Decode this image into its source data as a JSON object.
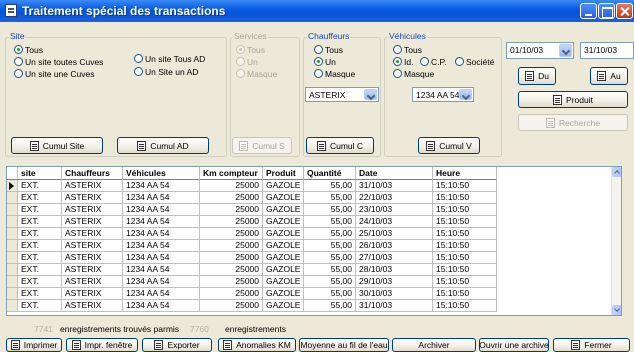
{
  "window": {
    "title": "Traitement spécial des transactions"
  },
  "site": {
    "title": "Site",
    "options": [
      "Tous",
      "Un site toutes Cuves",
      "Un site une Cuves",
      "Un site Tous AD",
      "Un Site un AD"
    ],
    "selected": "Tous",
    "cumul_site": "Cumul Site",
    "cumul_ad": "Cumul AD"
  },
  "services": {
    "title": "Services",
    "options": [
      "Tous",
      "Un",
      "Masque"
    ],
    "selected": "Tous",
    "cumul": "Cumul S"
  },
  "chauffeurs": {
    "title": "Chauffeurs",
    "options": [
      "Tous",
      "Un",
      "Masque"
    ],
    "selected": "Un",
    "combo_value": "ASTERIX",
    "cumul": "Cumul C"
  },
  "vehicules": {
    "title": "Véhicules",
    "options": [
      "Tous",
      "Id.",
      "C.P.",
      "Société",
      "Masque"
    ],
    "selected": "Id.",
    "combo_value": "1234 AA 54",
    "cumul": "Cumul V"
  },
  "dates": {
    "from": "01/10/03",
    "to": "31/10/03",
    "du_label": "Du",
    "au_label": "Au",
    "produit_label": "Produit",
    "recherche_label": "Recherche"
  },
  "table": {
    "columns": [
      "site",
      "Chauffeurs",
      "Véhicules",
      "Km compteur",
      "Produit",
      "Quantité",
      "Date",
      "Heure"
    ],
    "rows": [
      [
        "EXT.",
        "ASTERIX",
        "1234 AA 54",
        "25000",
        "GAZOLE",
        "55,00",
        "31/10/03",
        "15:10:50"
      ],
      [
        "EXT.",
        "ASTERIX",
        "1234 AA 54",
        "25000",
        "GAZOLE",
        "55,00",
        "22/10/03",
        "15:10:50"
      ],
      [
        "EXT.",
        "ASTERIX",
        "1234 AA 54",
        "25000",
        "GAZOLE",
        "55,00",
        "23/10/03",
        "15:10:50"
      ],
      [
        "EXT.",
        "ASTERIX",
        "1234 AA 54",
        "25000",
        "GAZOLE",
        "55,00",
        "24/10/03",
        "15:10:50"
      ],
      [
        "EXT.",
        "ASTERIX",
        "1234 AA 54",
        "25000",
        "GAZOLE",
        "55,00",
        "25/10/03",
        "15:10:50"
      ],
      [
        "EXT.",
        "ASTERIX",
        "1234 AA 54",
        "25000",
        "GAZOLE",
        "55,00",
        "26/10/03",
        "15:10:50"
      ],
      [
        "EXT.",
        "ASTERIX",
        "1234 AA 54",
        "25000",
        "GAZOLE",
        "55,00",
        "27/10/03",
        "15:10:50"
      ],
      [
        "EXT.",
        "ASTERIX",
        "1234 AA 54",
        "25000",
        "GAZOLE",
        "55,00",
        "28/10/03",
        "15:10:50"
      ],
      [
        "EXT.",
        "ASTERIX",
        "1234 AA 54",
        "25000",
        "GAZOLE",
        "55,00",
        "29/10/03",
        "15:10:50"
      ],
      [
        "EXT.",
        "ASTERIX",
        "1234 AA 54",
        "25000",
        "GAZOLE",
        "55,00",
        "30/10/03",
        "15:10:50"
      ],
      [
        "EXT.",
        "ASTERIX",
        "1234 AA 54",
        "25000",
        "GAZOLE",
        "55,00",
        "31/10/03",
        "15:10:50"
      ]
    ]
  },
  "status": {
    "found_count": "7741",
    "found_label": "enregistrements trouvés parmis",
    "total_count": "7760",
    "total_label": "enregistrements"
  },
  "bottom_buttons": {
    "imprimer": "Imprimer",
    "impr_fenetre": "Impr. fenêtre",
    "exporter": "Exporter",
    "anomalies": "Anomalies KM",
    "moyenne": "Moyenne au fil de l'eau",
    "archiver": "Archiver",
    "ouvrir_archive": "Ouvrir une archive",
    "fermer": "Fermer"
  }
}
